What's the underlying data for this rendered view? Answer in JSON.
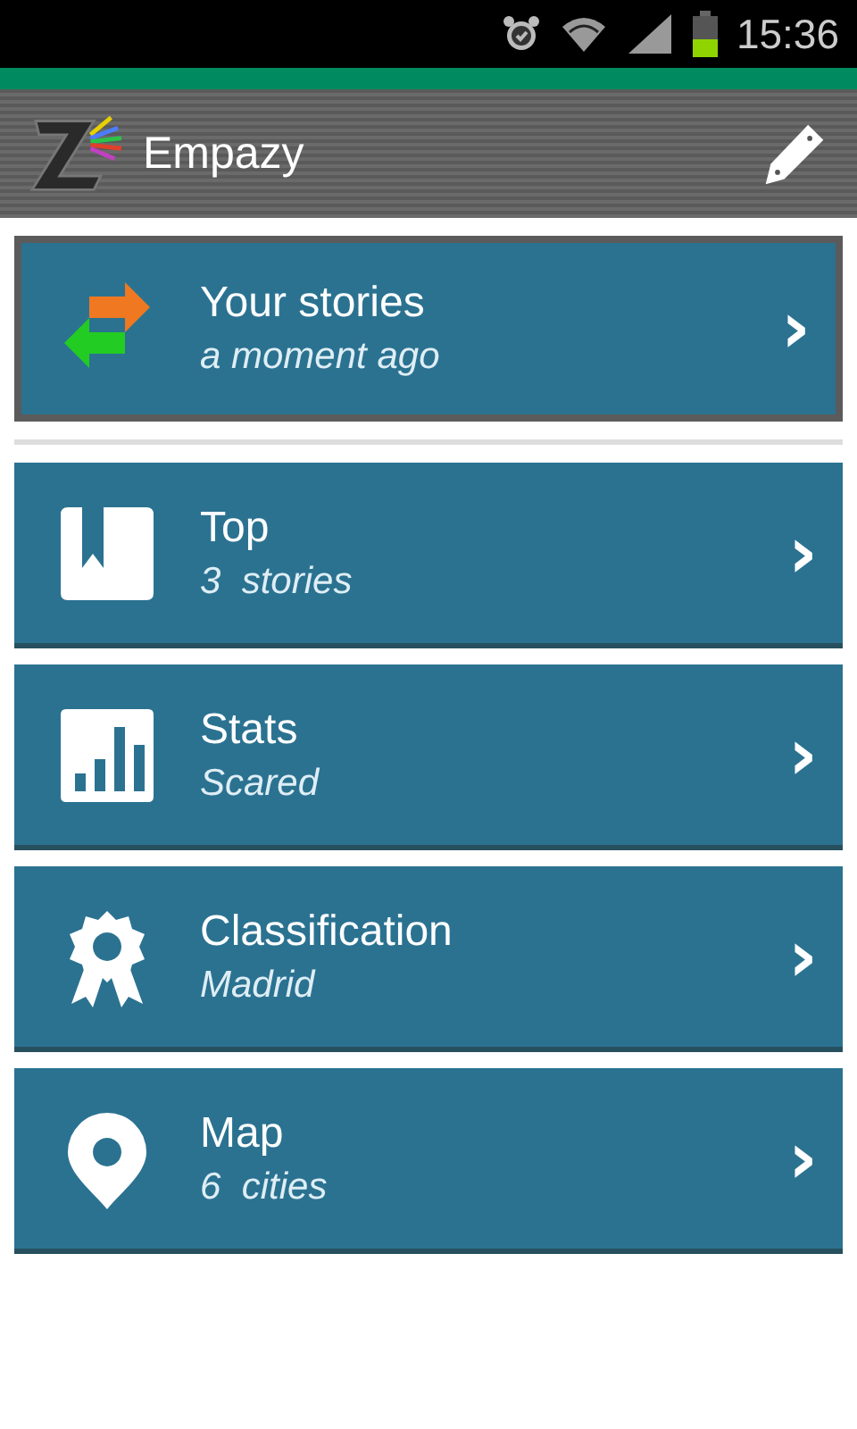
{
  "status_bar": {
    "time": "15:36"
  },
  "app_bar": {
    "title": "Empazy"
  },
  "featured": {
    "title": "Your stories",
    "subtitle": "a moment ago",
    "chevron": "›"
  },
  "items": [
    {
      "kind": "bookmark",
      "title": "Top",
      "subtitle": "3  stories",
      "chevron": "›"
    },
    {
      "kind": "stats",
      "title": "Stats",
      "subtitle": "Scared",
      "chevron": "›"
    },
    {
      "kind": "award",
      "title": "Classification",
      "subtitle": "Madrid",
      "chevron": "›"
    },
    {
      "kind": "pin",
      "title": "Map",
      "subtitle": "6  cities",
      "chevron": "›"
    }
  ]
}
